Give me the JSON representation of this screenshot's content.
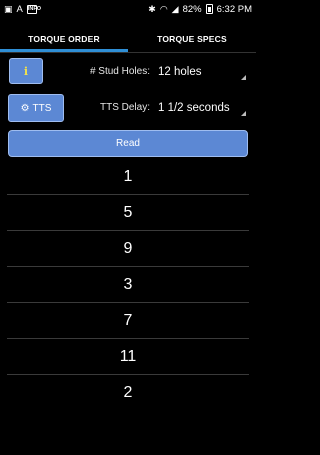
{
  "status_bar": {
    "left_text": "A",
    "left_badge": "INFO",
    "battery_percent": "82%",
    "time": "6:32 PM",
    "icons": [
      "font-size-icon",
      "app-badge-icon",
      "bluetooth-icon",
      "wifi-icon",
      "signal-icon",
      "battery-icon"
    ]
  },
  "tabs": [
    {
      "label": "TORQUE ORDER",
      "selected": true
    },
    {
      "label": "TORQUE SPECS",
      "selected": false
    }
  ],
  "controls": {
    "info_button_glyph": "i",
    "tts_button_label": "TTS",
    "stud_holes_label": "# Stud Holes:",
    "stud_holes_value": "12 holes",
    "tts_delay_label": "TTS Delay:",
    "tts_delay_value": "1 1/2 seconds",
    "read_button_label": "Read"
  },
  "colors": {
    "accent": "#2f8fd6",
    "button": "#5c88d4",
    "info_glyph": "#f2e24a"
  },
  "sequence": [
    "1",
    "5",
    "9",
    "3",
    "7",
    "11",
    "2"
  ]
}
